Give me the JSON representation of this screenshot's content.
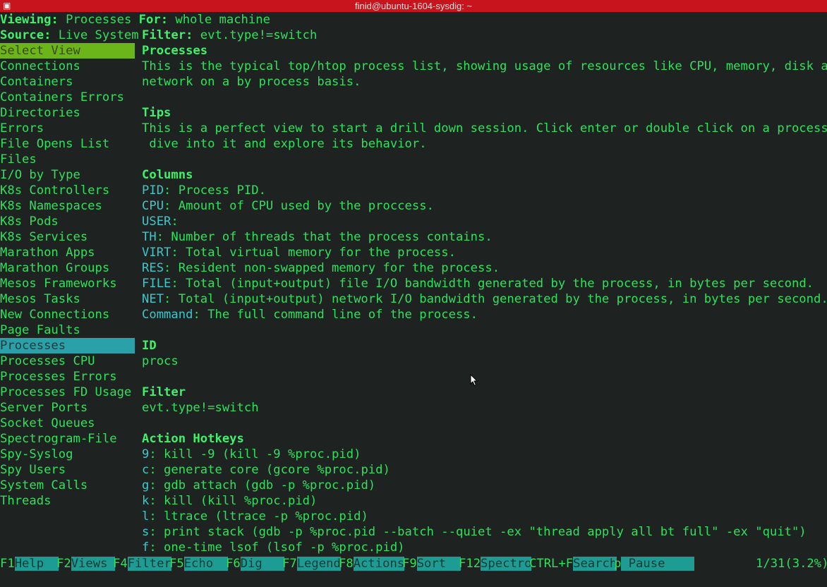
{
  "window": {
    "title": "finid@ubuntu-1604-sysdig: ~"
  },
  "header": {
    "viewing_label": "Viewing:",
    "viewing_value": "Processes",
    "for_label": "For:",
    "for_value": "whole machine",
    "source_label": "Source:",
    "source_value": "Live System",
    "filter_label": "Filter:",
    "filter_value": "evt.type!=switch"
  },
  "sidebar": {
    "header": "Select View",
    "selected": "Processes",
    "items": [
      "Connections",
      "Containers",
      "Containers Errors",
      "Directories",
      "Errors",
      "File Opens List",
      "Files",
      "I/O by Type",
      "K8s Controllers",
      "K8s Namespaces",
      "K8s Pods",
      "K8s Services",
      "Marathon Apps",
      "Marathon Groups",
      "Mesos Frameworks",
      "Mesos Tasks",
      "New Connections",
      "Page Faults",
      "Processes",
      "Processes CPU",
      "Processes Errors",
      "Processes FD Usage",
      "Server Ports",
      "Socket Queues",
      "Spectrogram-File",
      "Spy-Syslog",
      "Spy Users",
      "System Calls",
      "Threads"
    ]
  },
  "details": {
    "title": "Processes",
    "description_1": "This is the typical top/htop process list, showing usage of resources like CPU, memory, disk and",
    "description_2": "network on a by process basis.",
    "tips_heading": "Tips",
    "tips_1": "This is a perfect view to start a drill down session. Click enter or double click on a process to",
    "tips_2": " dive into it and explore its behavior.",
    "columns_heading": "Columns",
    "columns": [
      {
        "name": "PID",
        "desc": ": Process PID."
      },
      {
        "name": "CPU",
        "desc": ": Amount of CPU used by the proccess."
      },
      {
        "name": "USER",
        "desc": ":"
      },
      {
        "name": "TH",
        "desc": ": Number of threads that the process contains."
      },
      {
        "name": "VIRT",
        "desc": ": Total virtual memory for the process."
      },
      {
        "name": "RES",
        "desc": ": Resident non-swapped memory for the process."
      },
      {
        "name": "FILE",
        "desc": ": Total (input+output) file I/O bandwidth generated by the process, in bytes per second."
      },
      {
        "name": "NET",
        "desc": ": Total (input+output) network I/O bandwidth generated by the process, in bytes per second."
      },
      {
        "name": "Command",
        "desc": ": The full command line of the process."
      }
    ],
    "id_heading": "ID",
    "id_value": "procs",
    "filter_heading": "Filter",
    "filter_value": "evt.type!=switch",
    "hotkeys_heading": "Action Hotkeys",
    "hotkeys": [
      {
        "key": "9",
        "desc": ": kill -9 (kill -9 %proc.pid)"
      },
      {
        "key": "c",
        "desc": ": generate core (gcore %proc.pid)"
      },
      {
        "key": "g",
        "desc": ": gdb attach (gdb -p %proc.pid)"
      },
      {
        "key": "k",
        "desc": ": kill (kill %proc.pid)"
      },
      {
        "key": "l",
        "desc": ": ltrace (ltrace -p %proc.pid)"
      },
      {
        "key": "s",
        "desc": ": print stack (gdb -p %proc.pid --batch --quiet -ex \"thread apply all bt full\" -ex \"quit\")"
      },
      {
        "key": "f",
        "desc": ": one-time lsof (lsof -p %proc.pid)"
      }
    ]
  },
  "bottombar": {
    "items": [
      {
        "key": "F1",
        "label": "Help  "
      },
      {
        "key": "F2",
        "label": "Views "
      },
      {
        "key": "F4",
        "label": "Filter"
      },
      {
        "key": "F5",
        "label": "Echo  "
      },
      {
        "key": "F6",
        "label": "Dig   "
      },
      {
        "key": "F7",
        "label": "Legend"
      },
      {
        "key": "F8",
        "label": "Actions"
      },
      {
        "key": "F9",
        "label": "Sort  "
      },
      {
        "key": "F12",
        "label": "Spectro"
      },
      {
        "key": "CTRL+F",
        "label": "Search"
      },
      {
        "key": "p",
        "label": " Pause    "
      }
    ],
    "position": "1/31(3.2%)"
  }
}
